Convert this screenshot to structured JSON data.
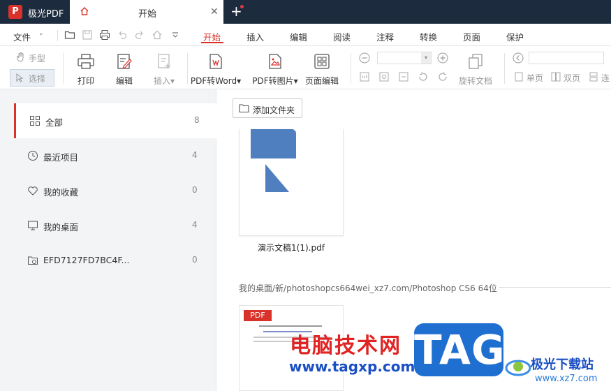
{
  "titlebar": {
    "app_name": "极光PDF",
    "logo_letter": "P",
    "tab_label": "开始",
    "close_glyph": "✕",
    "new_tab_glyph": "+"
  },
  "menubar": {
    "file_label": "文件",
    "file_arrow": "⌄",
    "tabs": [
      {
        "label": "开始",
        "active": true
      },
      {
        "label": "插入"
      },
      {
        "label": "编辑"
      },
      {
        "label": "阅读"
      },
      {
        "label": "注释"
      },
      {
        "label": "转换"
      },
      {
        "label": "页面"
      },
      {
        "label": "保护"
      }
    ]
  },
  "toolbar": {
    "hand_label": "手型",
    "select_label": "选择",
    "print_label": "打印",
    "edit_label": "编辑",
    "insert_label": "插入",
    "pdf_to_word_label": "PDF转Word",
    "pdf_to_image_label": "PDF转图片",
    "page_edit_label": "页面编辑",
    "rotate_label": "旋转文档",
    "single_page_label": "单页",
    "double_page_label": "双页",
    "continuous_label": "连",
    "dropdown_glyph": "▾"
  },
  "sidebar": {
    "items": [
      {
        "label": "全部",
        "count": "8"
      },
      {
        "label": "最近项目",
        "count": "4"
      },
      {
        "label": "我的收藏",
        "count": "0"
      },
      {
        "label": "我的桌面",
        "count": "4"
      },
      {
        "label": "EFD7127FD7BC4F...",
        "count": "0"
      }
    ]
  },
  "main": {
    "add_folder_label": "添加文件夹",
    "file1_name": "演示文稿1(1).pdf",
    "section_path": "我的桌面/新/photoshopcs664wei_xz7.com/Photoshop CS6 64位",
    "file2_badge": "PDF"
  },
  "watermark": {
    "cn_text": "电脑技术网",
    "url": "www.tagxp.com",
    "tag": "TAG",
    "site_name": "极光下载站",
    "site_url": "www.xz7.com"
  },
  "colors": {
    "accent": "#d9322b",
    "titlebar": "#1d2b3e",
    "sidebar_bg": "#f3f4f6",
    "slide_shape": "#4f7fbf"
  }
}
